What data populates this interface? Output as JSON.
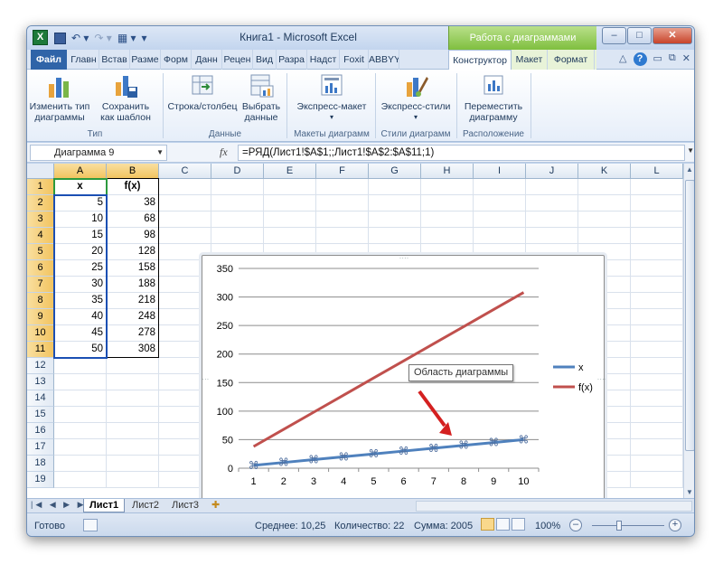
{
  "window": {
    "title": "Книга1  -  Microsoft Excel",
    "context_group": "Работа с диаграммами",
    "app_icon": "X"
  },
  "tabs": [
    "Файл",
    "Главн",
    "Встав",
    "Разме",
    "Форм",
    "Данн",
    "Рецен",
    "Вид",
    "Разра",
    "Надст",
    "Foxit",
    "ABBYY",
    "Конструктор",
    "Макет",
    "Формат"
  ],
  "ribbon": {
    "buttons": {
      "change_type": "Изменить тип\nдиаграммы",
      "save_template": "Сохранить\nкак шаблон",
      "row_col": "Строка/столбец",
      "select_data": "Выбрать\nданные",
      "express_layout": "Экспресс-макет",
      "express_styles": "Экспресс-стили",
      "move_chart": "Переместить\nдиаграмму"
    },
    "groups": {
      "type": "Тип",
      "data": "Данные",
      "layouts": "Макеты диаграмм",
      "styles": "Стили диаграмм",
      "location": "Расположение"
    }
  },
  "formula_bar": {
    "name_box": "Диаграмма 9",
    "fx": "fx",
    "formula": "=РЯД(Лист1!$A$1;;Лист1!$A$2:$A$11;1)"
  },
  "columns": [
    "A",
    "B",
    "C",
    "D",
    "E",
    "F",
    "G",
    "H",
    "I",
    "J",
    "K",
    "L"
  ],
  "rows": [
    "1",
    "2",
    "3",
    "4",
    "5",
    "6",
    "7",
    "8",
    "9",
    "10",
    "11",
    "12",
    "13",
    "14",
    "15",
    "16",
    "17",
    "18",
    "19"
  ],
  "table": {
    "headers": [
      "x",
      "f(x)"
    ],
    "x": [
      "5",
      "10",
      "15",
      "20",
      "25",
      "30",
      "35",
      "40",
      "45",
      "50"
    ],
    "fx": [
      "38",
      "68",
      "98",
      "128",
      "158",
      "188",
      "218",
      "248",
      "278",
      "308"
    ]
  },
  "chart_data": {
    "type": "line",
    "categories": [
      "1",
      "2",
      "3",
      "4",
      "5",
      "6",
      "7",
      "8",
      "9",
      "10"
    ],
    "series": [
      {
        "name": "x",
        "values": [
          5,
          10,
          15,
          20,
          25,
          30,
          35,
          40,
          45,
          50
        ],
        "color": "#4f81bd"
      },
      {
        "name": "f(x)",
        "values": [
          38,
          68,
          98,
          128,
          158,
          188,
          218,
          248,
          278,
          308
        ],
        "color": "#c0504d"
      }
    ],
    "ylim": [
      0,
      350
    ],
    "yticks": [
      "0",
      "50",
      "100",
      "150",
      "200",
      "250",
      "300",
      "350"
    ],
    "grid": true,
    "legend": "right"
  },
  "tooltip": "Область диаграммы",
  "sheets": [
    "Лист1",
    "Лист2",
    "Лист3"
  ],
  "status": {
    "ready": "Готово",
    "average": "Среднее: 10,25",
    "count": "Количество: 22",
    "sum": "Сумма: 2005",
    "zoom": "100%"
  }
}
